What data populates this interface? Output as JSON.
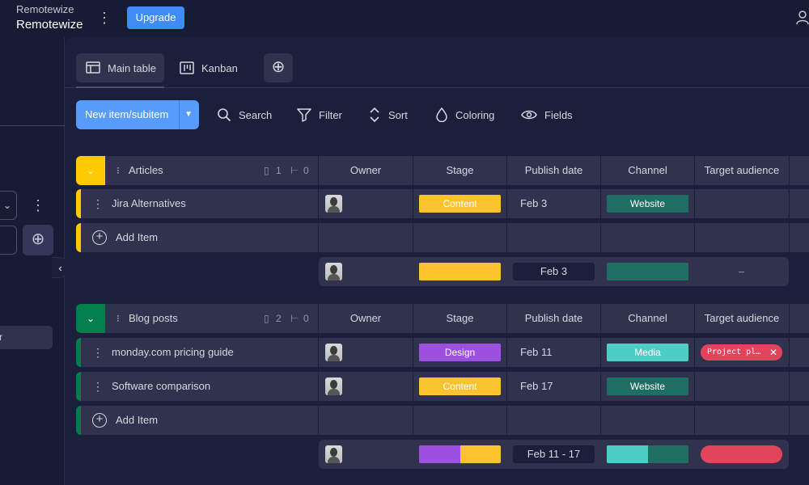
{
  "topbar": {
    "workspace_sub": "Remotewize",
    "workspace_name": "Remotewize",
    "upgrade_label": "Upgrade"
  },
  "left_panel": {
    "item_label": "r"
  },
  "views": {
    "main_table": "Main table",
    "kanban": "Kanban"
  },
  "toolbar": {
    "new_item": "New item/subitem",
    "search": "Search",
    "filter": "Filter",
    "sort": "Sort",
    "coloring": "Coloring",
    "fields": "Fields"
  },
  "columns": [
    "Owner",
    "Stage",
    "Publish date",
    "Channel",
    "Target audience"
  ],
  "colors": {
    "yellow_group": "#ffcb00",
    "green_group": "#037f4c",
    "content": "#fdc32f",
    "design": "#9d50dd",
    "website": "#1f6e64",
    "media": "#4eccc6",
    "target": "#e2445c",
    "primary": "#579bfc"
  },
  "groups": [
    {
      "name": "Articles",
      "docs": "1",
      "subitems": "0",
      "rows": [
        {
          "name": "Jira Alternatives",
          "stage": "Content",
          "date": "Feb 3",
          "channel": "Website",
          "target": ""
        }
      ],
      "add_item": "Add Item",
      "summary": {
        "date": "Feb 3",
        "target": "–"
      }
    },
    {
      "name": "Blog posts",
      "docs": "2",
      "subitems": "0",
      "rows": [
        {
          "name": "monday.com pricing guide",
          "stage": "Design",
          "date": "Feb 11",
          "channel": "Media",
          "target": "Project pl…"
        },
        {
          "name": "Software comparison",
          "stage": "Content",
          "date": "Feb 17",
          "channel": "Website",
          "target": ""
        }
      ],
      "add_item": "Add Item",
      "summary": {
        "date": "Feb 11 - 17"
      }
    }
  ]
}
